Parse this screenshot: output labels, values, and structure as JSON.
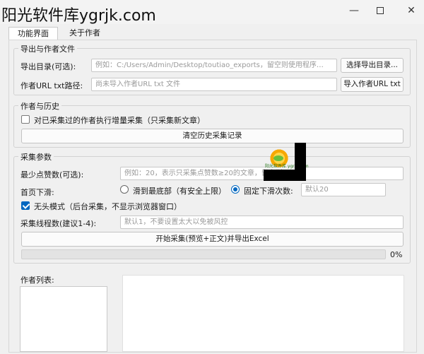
{
  "window": {
    "watermark": "阳光软件库ygrjk.com",
    "controls": {
      "minimize": "—",
      "maximize": "",
      "close": "✕"
    }
  },
  "tabs": [
    {
      "label": "功能界面",
      "active": true
    },
    {
      "label": "关于作者",
      "active": false
    }
  ],
  "export_group": {
    "title": "导出与作者文件",
    "export_dir_label": "导出目录(可选):",
    "export_dir_placeholder": "例如：C:/Users/Admin/Desktop/toutiao_exports，留空则使用程序…",
    "choose_dir_button": "选择导出目录...",
    "author_file_label": "作者URL txt路径:",
    "author_file_placeholder": "尚未导入作者URL txt 文件",
    "import_button": "导入作者URL txt"
  },
  "history_group": {
    "title": "作者与历史",
    "incremental_checkbox": "对已采集过的作者执行增量采集（只采集新文章）",
    "incremental_checked": false,
    "clear_history_button": "清空历史采集记录"
  },
  "params_group": {
    "title": "采集参数",
    "min_likes_label": "最少点赞数(可选):",
    "min_likes_placeholder": "例如：20，表示只采集点赞数≥20的文章，留空则不过滤",
    "scroll_label": "首页下滑:",
    "scroll_option_bottom": "滑到最底部（有安全上限）",
    "scroll_option_fixed": "固定下滑次数:",
    "scroll_selected": "fixed",
    "scroll_count_placeholder": "默认20",
    "headless_checkbox": "无头模式（后台采集，不显示浏览器窗口）",
    "headless_checked": true,
    "threads_label": "采集线程数(建议1-4):",
    "threads_placeholder": "默认1，不要设置太大以免被风控",
    "start_button": "开始采集(预览+正文)并导出Excel",
    "progress_percent": 0,
    "progress_text": "0%"
  },
  "author_list": {
    "label": "作者列表:"
  },
  "logo": {
    "text": "阳光软件库 ygrjk.com"
  }
}
